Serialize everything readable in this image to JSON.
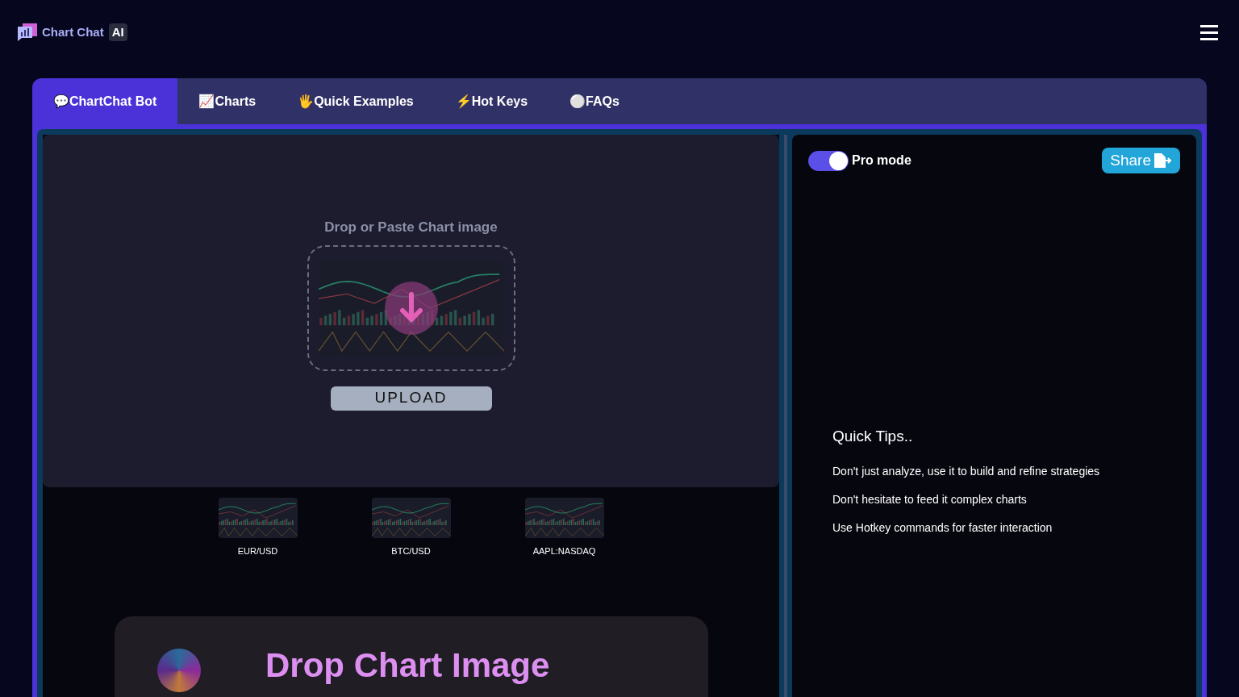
{
  "header": {
    "brand": "Chart Chat",
    "brand_badge": "AI"
  },
  "tabs": [
    {
      "label": "💬ChartChat Bot",
      "selected": true
    },
    {
      "label": "📈Charts",
      "selected": false
    },
    {
      "label": "🖐Quick Examples",
      "selected": false
    },
    {
      "label": "⚡Hot Keys",
      "selected": false
    },
    {
      "label": "⚪FAQs",
      "selected": false
    }
  ],
  "upload": {
    "heading": "Drop or Paste Chart image",
    "button": "UPLOAD"
  },
  "examples": [
    {
      "label": "EUR/USD"
    },
    {
      "label": "BTC/USD"
    },
    {
      "label": "AAPL:NASDAQ"
    }
  ],
  "drop_card": {
    "title": "Drop Chart Image"
  },
  "chat": {
    "pro_mode": {
      "label": "Pro mode",
      "on": true
    },
    "share_button": "Share",
    "tips_title": "Quick Tips..",
    "tips": [
      "Don't just analyze, use it to build and refine strategies",
      "Don't hesitate to feed it complex charts",
      "Use Hotkey commands for faster interaction"
    ]
  }
}
